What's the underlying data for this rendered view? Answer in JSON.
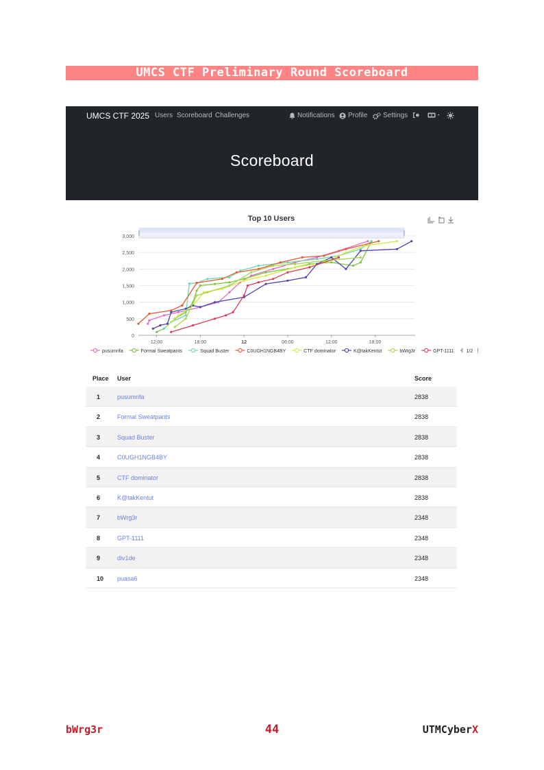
{
  "document": {
    "banner": "UMCS CTF Preliminary Round Scoreboard",
    "footer_left": "bWrg3r",
    "footer_page": "44",
    "footer_right_main": "UTMCyber",
    "footer_right_accent": "X",
    "colors": {
      "banner_bg": "#ff8585",
      "footer_red": "#c0202a"
    }
  },
  "navbar": {
    "brand": "UMCS CTF 2025",
    "links": [
      "Users",
      "Scoreboard",
      "Challenges"
    ],
    "right": {
      "notifications": "Notifications",
      "profile": "Profile",
      "settings": "Settings",
      "icons": [
        "bell-icon",
        "user-icon",
        "gears-icon",
        "logout-icon",
        "language-icon",
        "theme-icon"
      ]
    },
    "hero_title": "Scoreboard"
  },
  "chart_data": {
    "type": "line",
    "title": "Top 10 Users",
    "y_ticks": [
      "0",
      "500",
      "1,000",
      "1,500",
      "2,000",
      "2,500",
      "3,000"
    ],
    "ylim": [
      0,
      3000
    ],
    "x_ticks": [
      "12:00",
      "18:00",
      "12",
      "06:00",
      "12:00",
      "18:00"
    ],
    "x_unit": "hours since day-1 00:00",
    "x_tick_values": [
      12,
      18,
      24,
      30,
      36,
      42
    ],
    "xlim": [
      9.5,
      47.5
    ],
    "legend_pager": "1/2",
    "grid": true,
    "legend_position": "bottom",
    "series": [
      {
        "name": "pusumrifa",
        "color": "#e06bc2",
        "points": [
          [
            10.8,
            350
          ],
          [
            11,
            450
          ],
          [
            13,
            600
          ],
          [
            15,
            700
          ],
          [
            18,
            850
          ],
          [
            20.5,
            1000
          ],
          [
            22,
            1300
          ],
          [
            23.5,
            1600
          ],
          [
            25,
            1800
          ],
          [
            28,
            2000
          ],
          [
            31,
            2200
          ],
          [
            34,
            2350
          ],
          [
            37,
            2550
          ],
          [
            41,
            2838
          ]
        ]
      },
      {
        "name": "Formal Sweatpants",
        "color": "#7cc53a",
        "points": [
          [
            12,
            100
          ],
          [
            13,
            200
          ],
          [
            14.5,
            500
          ],
          [
            16,
            700
          ],
          [
            17,
            1000
          ],
          [
            17.5,
            1350
          ],
          [
            18,
            1500
          ],
          [
            20,
            1550
          ],
          [
            22,
            1600
          ],
          [
            24,
            1700
          ],
          [
            27,
            1900
          ],
          [
            30,
            2000
          ],
          [
            33,
            2150
          ],
          [
            36,
            2200
          ],
          [
            39,
            2100
          ],
          [
            40,
            2200
          ],
          [
            41.5,
            2838
          ]
        ]
      },
      {
        "name": "Squad Buster",
        "color": "#6cd6aa",
        "points": [
          [
            13,
            200
          ],
          [
            14,
            400
          ],
          [
            16,
            600
          ],
          [
            16.5,
            1560
          ],
          [
            17.5,
            1580
          ],
          [
            19,
            1700
          ],
          [
            22,
            1750
          ],
          [
            23.5,
            1950
          ],
          [
            26,
            2100
          ],
          [
            30,
            2200
          ],
          [
            34,
            2300
          ],
          [
            37,
            2400
          ],
          [
            40,
            2600
          ],
          [
            41.5,
            2838
          ]
        ]
      },
      {
        "name": "C0UGH1NGB4BY",
        "color": "#e05a2f",
        "points": [
          [
            9.5,
            350
          ],
          [
            11,
            650
          ],
          [
            14,
            750
          ],
          [
            15.5,
            900
          ],
          [
            17.5,
            1580
          ],
          [
            21,
            1700
          ],
          [
            23,
            1900
          ],
          [
            26,
            2000
          ],
          [
            29,
            2200
          ],
          [
            32,
            2350
          ],
          [
            35,
            2400
          ],
          [
            38,
            2600
          ],
          [
            42.5,
            2838
          ]
        ]
      },
      {
        "name": "CTF dominator",
        "color": "#d6e840",
        "points": [
          [
            13.5,
            300
          ],
          [
            15,
            600
          ],
          [
            17,
            900
          ],
          [
            18.5,
            1300
          ],
          [
            21,
            1400
          ],
          [
            24,
            1650
          ],
          [
            27,
            1800
          ],
          [
            31,
            2050
          ],
          [
            35,
            2200
          ],
          [
            38,
            2500
          ],
          [
            40.5,
            2700
          ],
          [
            45,
            2838
          ]
        ]
      },
      {
        "name": "K@takKentut",
        "color": "#4b44b3",
        "points": [
          [
            11.5,
            200
          ],
          [
            12.5,
            300
          ],
          [
            13.5,
            350
          ],
          [
            14,
            700
          ],
          [
            16,
            800
          ],
          [
            17,
            900
          ],
          [
            18,
            850
          ],
          [
            20,
            1000
          ],
          [
            24,
            1150
          ],
          [
            27,
            1550
          ],
          [
            30,
            1650
          ],
          [
            32.5,
            1750
          ],
          [
            34,
            2150
          ],
          [
            36,
            2350
          ],
          [
            38,
            2000
          ],
          [
            40,
            2550
          ],
          [
            45,
            2600
          ],
          [
            47,
            2838
          ]
        ]
      },
      {
        "name": "bWrg3r",
        "color": "#a4d64a",
        "points": [
          [
            14.5,
            250
          ],
          [
            16,
            500
          ],
          [
            17.5,
            1200
          ],
          [
            19,
            1300
          ],
          [
            22,
            1500
          ],
          [
            25,
            1900
          ],
          [
            28,
            2100
          ],
          [
            31,
            2150
          ],
          [
            35,
            2250
          ],
          [
            40,
            2348
          ]
        ]
      },
      {
        "name": "GPT-1111",
        "color": "#d63a55",
        "points": [
          [
            14,
            100
          ],
          [
            17,
            300
          ],
          [
            20,
            500
          ],
          [
            21.5,
            600
          ],
          [
            22.5,
            700
          ],
          [
            24,
            1200
          ],
          [
            24.5,
            1500
          ],
          [
            26,
            1600
          ],
          [
            28,
            1700
          ],
          [
            30,
            1900
          ],
          [
            33,
            2050
          ],
          [
            37,
            2348
          ]
        ]
      }
    ]
  },
  "table": {
    "headers": {
      "place": "Place",
      "user": "User",
      "score": "Score"
    },
    "rows": [
      {
        "place": "1",
        "user": "pusumrifa",
        "score": "2838"
      },
      {
        "place": "2",
        "user": "Formal Sweatpants",
        "score": "2838"
      },
      {
        "place": "3",
        "user": "Squad Buster",
        "score": "2838"
      },
      {
        "place": "4",
        "user": "C0UGH1NGB4BY",
        "score": "2838"
      },
      {
        "place": "5",
        "user": "CTF dominator",
        "score": "2838"
      },
      {
        "place": "6",
        "user": "K@takKentut",
        "score": "2838"
      },
      {
        "place": "7",
        "user": "bWrg3r",
        "score": "2348"
      },
      {
        "place": "8",
        "user": "GPT-1111",
        "score": "2348"
      },
      {
        "place": "9",
        "user": "div1de",
        "score": "2348"
      },
      {
        "place": "10",
        "user": "puasa6",
        "score": "2348"
      }
    ]
  }
}
